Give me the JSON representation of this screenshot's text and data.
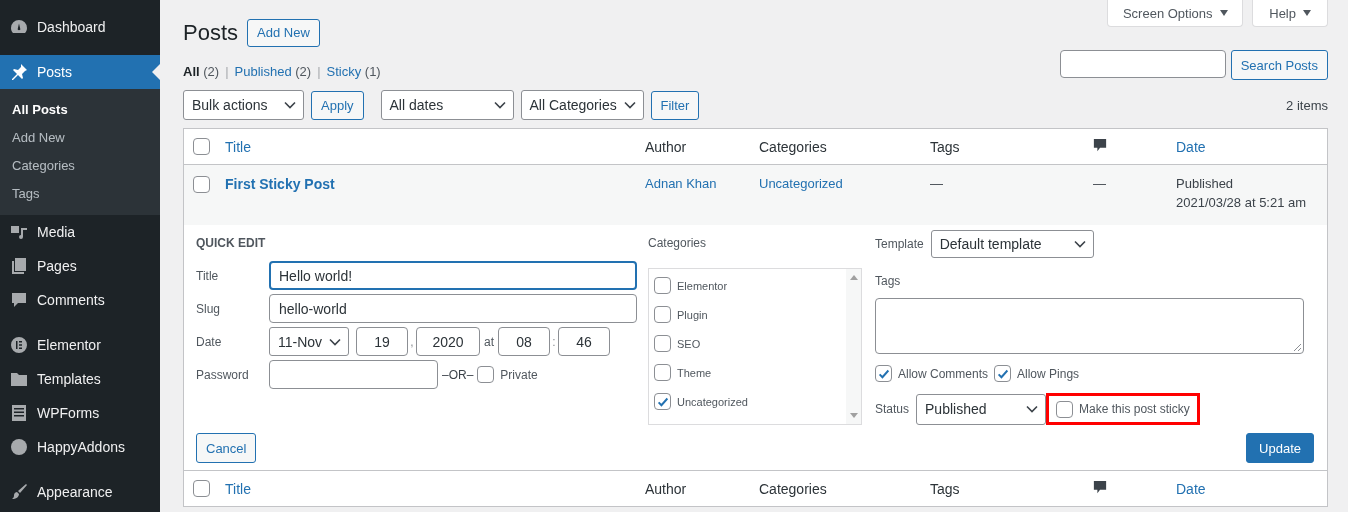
{
  "sidebar": {
    "sections": [
      [
        {
          "label": "Dashboard",
          "selected": false
        }
      ],
      [
        {
          "label": "Posts",
          "selected": true,
          "children": [
            {
              "label": "All Posts",
              "selected": true
            },
            {
              "label": "Add New",
              "selected": false
            },
            {
              "label": "Categories",
              "selected": false
            },
            {
              "label": "Tags",
              "selected": false
            }
          ]
        },
        {
          "label": "Media",
          "selected": false
        },
        {
          "label": "Pages",
          "selected": false
        },
        {
          "label": "Comments",
          "selected": false
        }
      ],
      [
        {
          "label": "Elementor",
          "selected": false
        },
        {
          "label": "Templates",
          "selected": false
        },
        {
          "label": "WPForms",
          "selected": false
        },
        {
          "label": "HappyAddons",
          "selected": false
        }
      ],
      [
        {
          "label": "Appearance",
          "selected": false
        }
      ]
    ]
  },
  "header": {
    "title": "Posts",
    "add_new": "Add New",
    "screen_options": "Screen Options",
    "help": "Help"
  },
  "views": {
    "separator": "|",
    "items": [
      {
        "label": "All",
        "count": "(2)",
        "selected": true
      },
      {
        "label": "Published",
        "count": "(2)",
        "selected": false
      },
      {
        "label": "Sticky",
        "count": "(1)",
        "selected": false
      }
    ]
  },
  "search": {
    "button": "Search Posts"
  },
  "filters": {
    "bulk_actions": "Bulk actions",
    "apply": "Apply",
    "dates": "All dates",
    "categories": "All Categories",
    "filter": "Filter"
  },
  "item_count": "2 items",
  "table": {
    "select_all_checked": false,
    "footer_select_all_checked": false,
    "columns": [
      {
        "kind": "text",
        "label": "Title",
        "sortable": true
      },
      {
        "kind": "text",
        "label": "Author",
        "sortable": false
      },
      {
        "kind": "text",
        "label": "Categories",
        "sortable": false
      },
      {
        "kind": "text",
        "label": "Tags",
        "sortable": false
      },
      {
        "kind": "icon",
        "sortable": false
      },
      {
        "kind": "text",
        "label": "Date",
        "sortable": true
      }
    ],
    "rows": [
      {
        "checked": false,
        "title": "First Sticky Post",
        "author": "Adnan Khan",
        "categories": "Uncategorized",
        "tags": "—",
        "comments": "—",
        "status": "Published",
        "date": "2021/03/28 at 5:21 am"
      }
    ],
    "footer_columns": [
      {
        "kind": "text",
        "label": "Title",
        "sortable": true
      },
      {
        "kind": "text",
        "label": "Author",
        "sortable": false
      },
      {
        "kind": "text",
        "label": "Categories",
        "sortable": false
      },
      {
        "kind": "text",
        "label": "Tags",
        "sortable": false
      },
      {
        "kind": "icon",
        "sortable": false
      },
      {
        "kind": "text",
        "label": "Date",
        "sortable": true
      }
    ]
  },
  "quick_edit": {
    "heading": "QUICK EDIT",
    "title": {
      "label": "Title",
      "value": "Hello world!",
      "focused": true
    },
    "slug": {
      "label": "Slug",
      "value": "hello-world"
    },
    "date": {
      "label": "Date",
      "month": "11-Nov",
      "day": "19",
      "sep1": ",",
      "year": "2020",
      "at": "at",
      "hour": "08",
      "sep2": ":",
      "minute": "46"
    },
    "password": {
      "label": "Password",
      "or": "–OR–",
      "private": {
        "label": "Private",
        "checked": false
      }
    },
    "categories": {
      "label": "Categories",
      "items": [
        {
          "label": "Elementor",
          "checked": false
        },
        {
          "label": "Plugin",
          "checked": false
        },
        {
          "label": "SEO",
          "checked": false
        },
        {
          "label": "Theme",
          "checked": false
        },
        {
          "label": "Uncategorized",
          "checked": true
        }
      ]
    },
    "template": {
      "label": "Template",
      "value": "Default template"
    },
    "tags": {
      "label": "Tags"
    },
    "options": [
      {
        "label": "Allow Comments",
        "checked": true
      },
      {
        "label": "Allow Pings",
        "checked": true
      }
    ],
    "status": {
      "label": "Status",
      "value": "Published"
    },
    "sticky": {
      "label": "Make this post sticky",
      "checked": false,
      "highlighted": true
    },
    "cancel": "Cancel",
    "update": "Update"
  }
}
